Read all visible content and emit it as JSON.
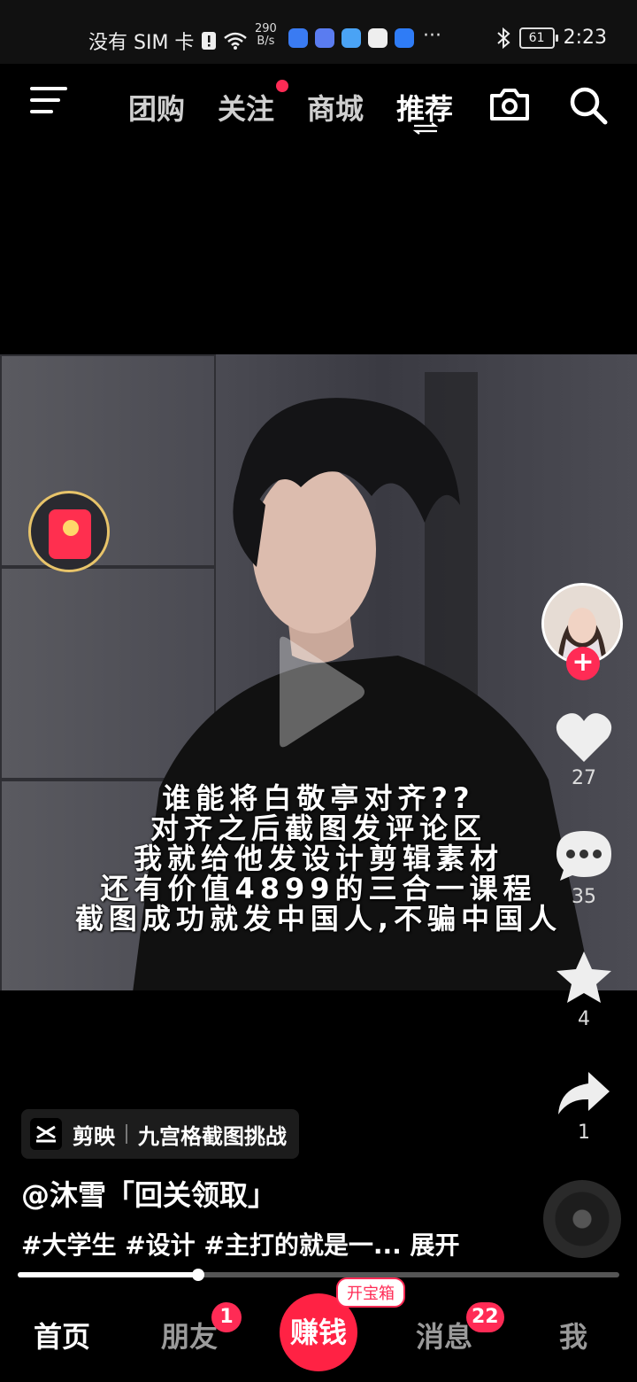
{
  "status_bar": {
    "carrier": "没有 SIM 卡",
    "net_speed_value": "290",
    "net_speed_unit": "B/s",
    "more": "···",
    "battery": "61",
    "time": "2:23"
  },
  "top_nav": {
    "tabs": [
      {
        "label": "团购"
      },
      {
        "label": "关注"
      },
      {
        "label": "商城"
      },
      {
        "label": "推荐"
      }
    ],
    "active_tab": "推荐"
  },
  "video": {
    "caption": [
      "谁能将白敬亭对齐??",
      "对齐之后截图发评论区",
      "我就给他发设计剪辑素材",
      "还有价值4899的三合一课程",
      "截图成功就发中国人,不骗中国人"
    ]
  },
  "sidebar": {
    "likes": "27",
    "comments": "35",
    "favorites": "4",
    "shares": "1",
    "follow_symbol": "+"
  },
  "info": {
    "chip_app": "剪映",
    "chip_topic": "九宫格截图挑战",
    "author": "@沐雪「回关领取」",
    "description": "#大学生 #设计 #主打的就是一... 展开",
    "progress": 0.3
  },
  "bottom_nav": {
    "home": "首页",
    "friends": "朋友",
    "friends_badge": "1",
    "earn": "赚钱",
    "earn_tag": "开宝箱",
    "messages": "消息",
    "messages_badge": "22",
    "me": "我"
  },
  "colors": {
    "accent": "#ff2b55",
    "background": "#000000"
  },
  "icons": [
    "menu-icon",
    "camera-icon",
    "search-icon",
    "play-icon",
    "heart-icon",
    "comment-icon",
    "star-icon",
    "share-icon",
    "red-envelope-icon",
    "music-disc-icon"
  ]
}
